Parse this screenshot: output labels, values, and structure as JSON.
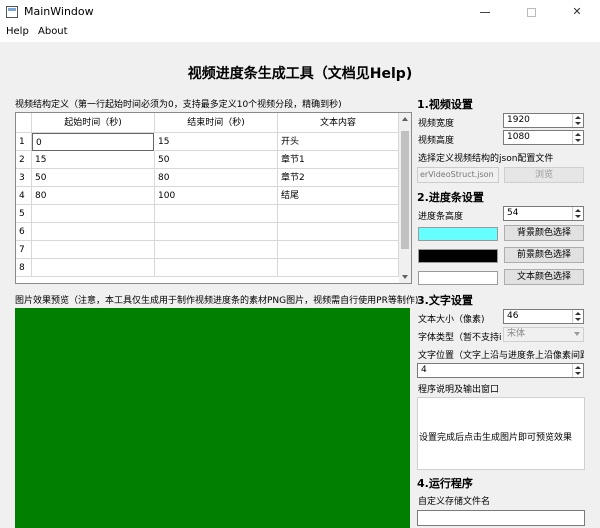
{
  "window": {
    "title": "MainWindow",
    "minimize_glyph": "minimize-icon",
    "maximize_glyph": "maximize-icon",
    "close_glyph": "✕"
  },
  "menu": {
    "items": [
      "Help",
      "About"
    ]
  },
  "main_title": "视频进度条生成工具（文档见Help)",
  "structure": {
    "label": "视频结构定义（第一行起始时间必须为0，支持最多定义10个视频分段，精确到秒)",
    "columns": [
      "起始时间（秒)",
      "结束时间（秒)",
      "文本内容"
    ],
    "row_numbers": [
      "1",
      "2",
      "3",
      "4",
      "5",
      "6",
      "7",
      "8"
    ],
    "rows": [
      [
        "0",
        "15",
        "开头"
      ],
      [
        "15",
        "50",
        "章节1"
      ],
      [
        "50",
        "80",
        "章节2"
      ],
      [
        "80",
        "100",
        "结尾"
      ],
      [
        "",
        "",
        ""
      ],
      [
        "",
        "",
        ""
      ],
      [
        "",
        "",
        ""
      ],
      [
        "",
        "",
        ""
      ]
    ]
  },
  "preview": {
    "label": "图片效果预览（注意，本工具仅生成用于制作视频进度条的素材PNG图片，视频需自行使用PR等制作)",
    "bg_color": "#007f00"
  },
  "video_settings": {
    "heading": "1.视频设置",
    "width_label": "视频宽度",
    "width_value": "1920",
    "height_label": "视频高度",
    "height_value": "1080",
    "json_label": "选择定义视频结构的json配置文件",
    "json_path": "erVideoStruct.json",
    "browse_label": "浏览"
  },
  "progress_settings": {
    "heading": "2.进度条设置",
    "height_label": "进度条高度",
    "height_value": "54",
    "bg_color": "#66ffff",
    "bg_button": "背景颜色选择",
    "fg_color": "#000000",
    "fg_button": "前景颜色选择",
    "text_color": "#ffffff",
    "text_button": "文本颜色选择"
  },
  "text_settings": {
    "heading": "3.文字设置",
    "size_label": "文本大小（像素)",
    "size_value": "46",
    "font_label": "字体类型（暂不支持i",
    "font_value": "宋体",
    "position_label": "文字位置（文字上沿与进度条上沿像素间距",
    "position_value": "4",
    "help_label": "程序说明及输出窗口",
    "help_text": "设置完成后点击生成图片即可预览效果"
  },
  "run": {
    "heading": "4.运行程序",
    "filename_label": "自定义存储文件名",
    "filename_value": ""
  }
}
